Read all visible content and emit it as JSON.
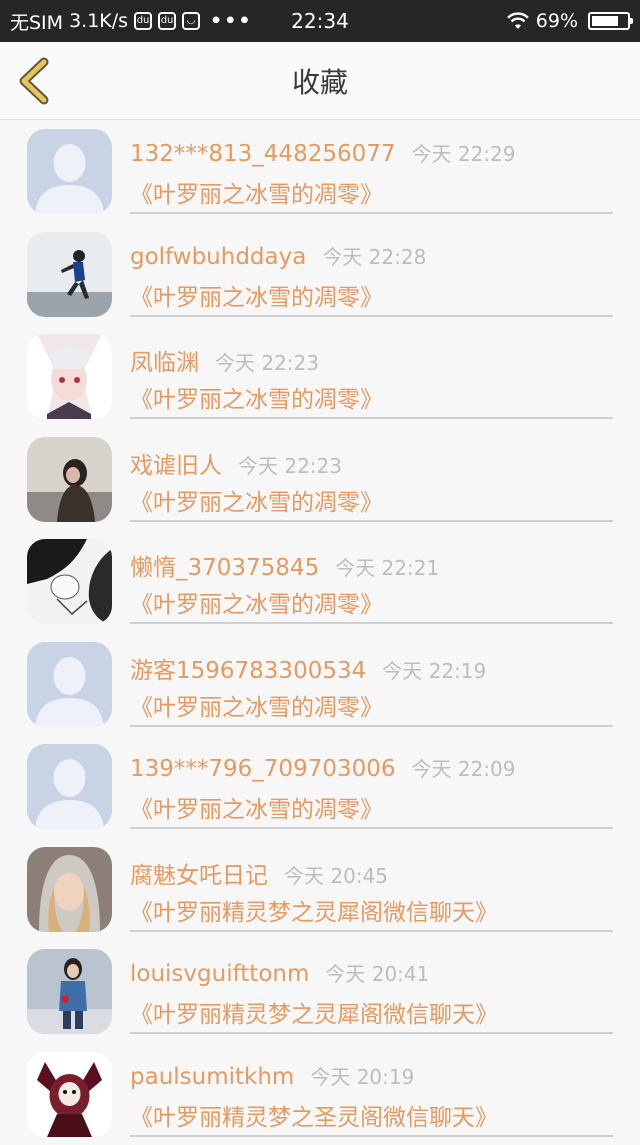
{
  "status_bar": {
    "carrier": "无SIM",
    "speed": "3.1K/s",
    "dots": "•••",
    "time": "22:34",
    "battery": "69%"
  },
  "header": {
    "title": "收藏"
  },
  "items": [
    {
      "name": "132***813_448256077",
      "time": "今天 22:29",
      "title": "《叶罗丽之冰雪的凋零》"
    },
    {
      "name": "golfwbuhddaya",
      "time": "今天 22:28",
      "title": "《叶罗丽之冰雪的凋零》"
    },
    {
      "name": "凤临渊",
      "time": "今天 22:23",
      "title": "《叶罗丽之冰雪的凋零》"
    },
    {
      "name": "戏谑旧人",
      "time": "今天 22:23",
      "title": "《叶罗丽之冰雪的凋零》"
    },
    {
      "name": "懒惰_370375845",
      "time": "今天 22:21",
      "title": "《叶罗丽之冰雪的凋零》"
    },
    {
      "name": "游客1596783300534",
      "time": "今天 22:19",
      "title": "《叶罗丽之冰雪的凋零》"
    },
    {
      "name": "139***796_709703006",
      "time": "今天 22:09",
      "title": "《叶罗丽之冰雪的凋零》"
    },
    {
      "name": "腐魅女吒日记",
      "time": "今天 20:45",
      "title": "《叶罗丽精灵梦之灵犀阁微信聊天》"
    },
    {
      "name": "louisvguifttonm",
      "time": "今天 20:41",
      "title": "《叶罗丽精灵梦之灵犀阁微信聊天》"
    },
    {
      "name": "paulsumitkhm",
      "time": "今天 20:19",
      "title": "《叶罗丽精灵梦之圣灵阁微信聊天》"
    }
  ],
  "colors": {
    "accent": "#e49a60",
    "muted": "#bdbdbd",
    "back_arrow": "#e8c35a"
  },
  "icons": {
    "back": "chevron-left-icon",
    "wifi": "wifi-icon",
    "battery": "battery-icon"
  }
}
